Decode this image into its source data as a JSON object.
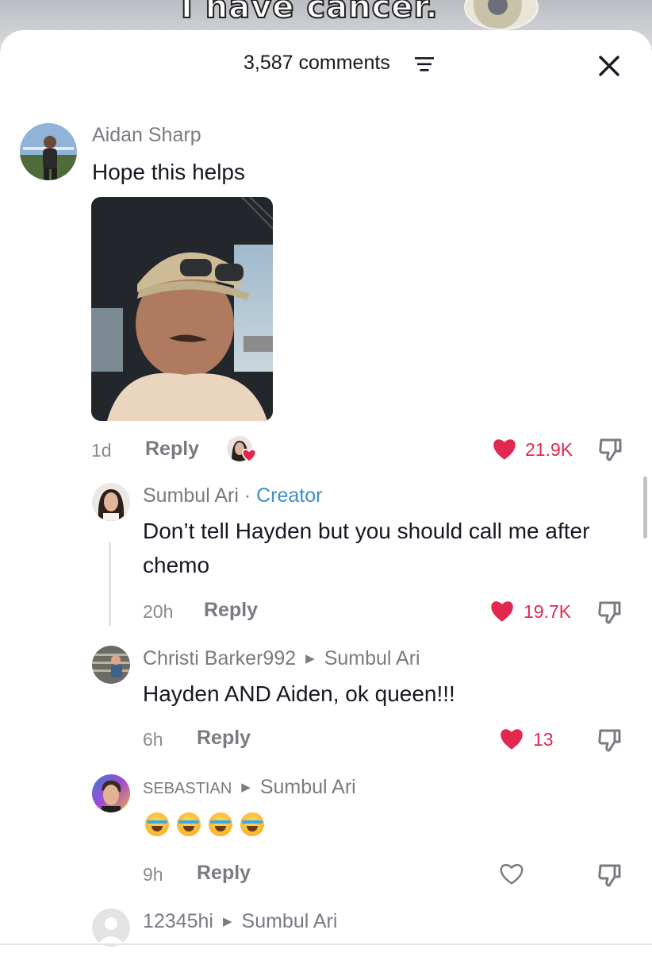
{
  "background": {
    "video_caption": "I have cancer."
  },
  "header": {
    "comment_count": "3,587 comments"
  },
  "comments": [
    {
      "username": "Aidan Sharp",
      "text": "Hope this helps",
      "time": "1d",
      "reply": "Reply",
      "likes": "21.9K",
      "liked": true
    }
  ],
  "replies": [
    {
      "username": "Sumbul Ari",
      "separator": " · ",
      "tag": "Creator",
      "text": "Don’t tell Hayden but you should call me after chemo",
      "time": "20h",
      "reply": "Reply",
      "likes": "19.7K",
      "liked": true
    },
    {
      "username": "Christi Barker992",
      "reply_to": "Sumbul Ari",
      "text": "Hayden AND Aiden, ok queen!!!",
      "time": "6h",
      "reply": "Reply",
      "likes": "13",
      "liked": true
    },
    {
      "username": "SEBASTIAN",
      "reply_to": "Sumbul Ari",
      "time": "9h",
      "reply": "Reply",
      "likes": "",
      "liked": false
    },
    {
      "username": "12345hi",
      "reply_to": "Sumbul Ari"
    }
  ],
  "colors": {
    "like_red": "#e2284f",
    "creator_blue": "#3e8ec7",
    "muted_text": "#7a7b82"
  }
}
